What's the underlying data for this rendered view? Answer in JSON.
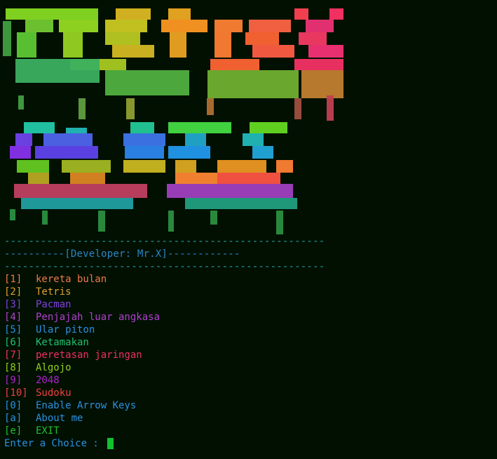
{
  "banner": {
    "description_icon": "ascii-art-banner-icon"
  },
  "separators": {
    "top": "-----------------------------------------------------",
    "developer": "----------[Developer: Mr.X]------------",
    "bottom": "-----------------------------------------------------"
  },
  "menu": [
    {
      "key": "[1]",
      "label": "kereta bulan",
      "color": "#f07a4a"
    },
    {
      "key": "[2]",
      "label": "Tetris",
      "color": "#e0a030"
    },
    {
      "key": "[3]",
      "label": "Pacman",
      "color": "#8040e0"
    },
    {
      "key": "[4]",
      "label": "Penjajah luar angkasa",
      "color": "#b040d0"
    },
    {
      "key": "[5]",
      "label": "Ular piton",
      "color": "#2a90e0"
    },
    {
      "key": "[6]",
      "label": "Ketamakan",
      "color": "#20c070"
    },
    {
      "key": "[7]",
      "label": "peretasan jaringan",
      "color": "#f03060"
    },
    {
      "key": "[8]",
      "label": "Algojo",
      "color": "#90d020"
    },
    {
      "key": "[9]",
      "label": "2048",
      "color": "#b020d0"
    },
    {
      "key": "[10]",
      "label": "Sudoku",
      "color": "#f04040"
    },
    {
      "key": "[0]",
      "label": "Enable Arrow Keys",
      "color": "#2a90e0"
    },
    {
      "key": "[a]",
      "label": "About me",
      "color": "#2a90e0"
    },
    {
      "key": "[e]",
      "label": "EXIT",
      "color": "#20c030"
    }
  ],
  "prompt": {
    "text": "Enter a Choice : ",
    "color": "#2a90e0",
    "cursor_color": "#12c030"
  }
}
